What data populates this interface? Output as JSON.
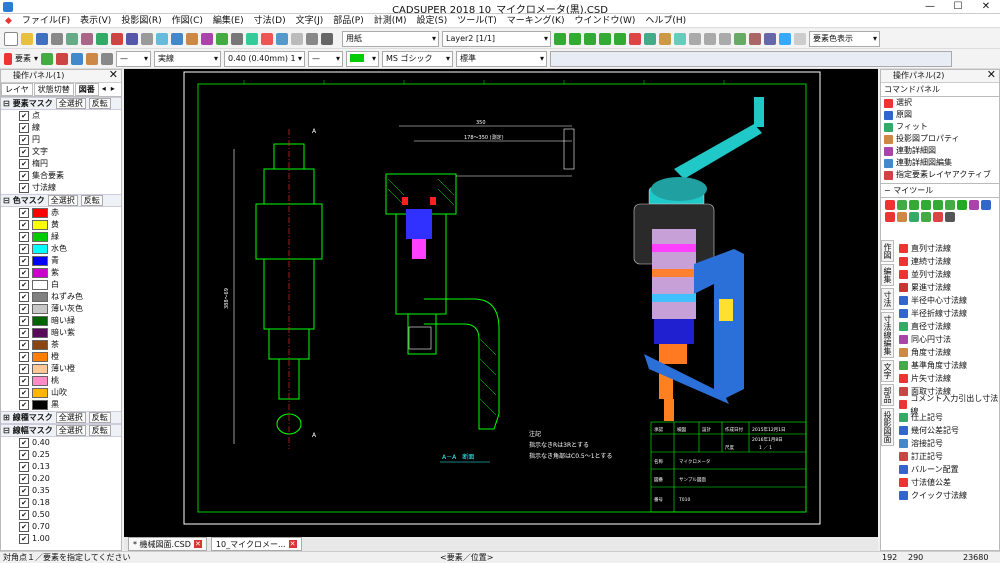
{
  "window": {
    "title": "CADSUPER 2018 10_マイクロメータ(黒).CSD"
  },
  "menu": [
    "ファイル(F)",
    "表示(V)",
    "投影図(R)",
    "作図(C)",
    "編集(E)",
    "寸法(D)",
    "文字(J)",
    "部品(P)",
    "計測(M)",
    "設定(S)",
    "ツール(T)",
    "マーキング(K)",
    "ウインドウ(W)",
    "ヘルプ(H)"
  ],
  "toolbar1": {
    "paper": "用紙",
    "layer": "Layer2 [1/1]",
    "color_display": "要素色表示"
  },
  "toolbar2": {
    "element": "要素",
    "linetype": "実線",
    "linewidth": "0.40 (0.40mm) 1",
    "font": "MS ゴシック",
    "style": "標準"
  },
  "left_panel": {
    "title": "操作パネル(1)",
    "tabs": [
      "レイヤ",
      "状態切替",
      "図番"
    ],
    "element_mask": {
      "label": "要素マスク",
      "select_all": "全選択",
      "invert": "反転",
      "items": [
        "点",
        "線",
        "円",
        "文字",
        "楕円",
        "集合要素",
        "寸法線"
      ]
    },
    "color_mask": {
      "label": "色マスク",
      "select_all": "全選択",
      "invert": "反転",
      "items": [
        {
          "name": "赤",
          "color": "#ff0000"
        },
        {
          "name": "黄",
          "color": "#ffff00"
        },
        {
          "name": "緑",
          "color": "#00cc00"
        },
        {
          "name": "水色",
          "color": "#00ffff"
        },
        {
          "name": "青",
          "color": "#0000ff"
        },
        {
          "name": "紫",
          "color": "#cc00cc"
        },
        {
          "name": "白",
          "color": "#ffffff"
        },
        {
          "name": "ねずみ色",
          "color": "#808080"
        },
        {
          "name": "薄い灰色",
          "color": "#c8c8c8"
        },
        {
          "name": "暗い緑",
          "color": "#006400"
        },
        {
          "name": "暗い紫",
          "color": "#5a0a5a"
        },
        {
          "name": "茶",
          "color": "#8b4513"
        },
        {
          "name": "橙",
          "color": "#ff8000"
        },
        {
          "name": "薄い橙",
          "color": "#ffc896"
        },
        {
          "name": "桃",
          "color": "#ff8cc8"
        },
        {
          "name": "山吹",
          "color": "#ffb400"
        },
        {
          "name": "黒",
          "color": "#000000"
        }
      ]
    },
    "linetype_mask": {
      "label": "線種マスク",
      "select_all": "全選択",
      "invert": "反転"
    },
    "linewidth_mask": {
      "label": "線幅マスク",
      "select_all": "全選択",
      "invert": "反転",
      "items": [
        "0.40",
        "0.25",
        "0.13",
        "0.20",
        "0.35",
        "0.18",
        "0.50",
        "0.70",
        "1.00"
      ]
    }
  },
  "drawing": {
    "dim_top": "350",
    "dim_top2": "178～350 (測定)",
    "dim_side": "388～69",
    "section_label_a": "A",
    "section_caption": "A－A　断面",
    "notes": [
      "注記",
      "指示なきRは3Rとする",
      "指示なき角部はC0.5～1とする"
    ],
    "title_block": {
      "headers": [
        "承認",
        "検図",
        "設計",
        "作成日付",
        "2015年12月1日"
      ],
      "revised": "2016年1月8日",
      "scale_label": "尺度",
      "scale": "1 ／ 1",
      "name_label": "名称",
      "name": "マイクロメータ",
      "company_label": "図番",
      "company": "サンプル図面",
      "number_label": "番号",
      "number": "T010"
    }
  },
  "doc_tabs": [
    "* 機械図面.CSD",
    "10_マイクロメー..."
  ],
  "status": {
    "left": "対角点１／要素を指定してください",
    "center": "<要素／位置>",
    "x": "192",
    "y": "290",
    "z": "23680"
  },
  "right_panel": {
    "title": "操作パネル(2)",
    "cmd_tab": "コマンドパネル",
    "commands": [
      "選択",
      "原図",
      "フィット",
      "投影図プロパティ",
      "連動詳細図",
      "連動詳細図編集",
      "指定要素レイヤアクティブ"
    ],
    "mytools_label": "マイツール",
    "vtabs": [
      "作図",
      "編集",
      "寸法",
      "寸法線編集",
      "文字",
      "部品",
      "投影図面"
    ],
    "dim_tools": [
      "直列寸法線",
      "連続寸法線",
      "並列寸法線",
      "累進寸法線",
      "半径中心寸法線",
      "半径折線寸法線",
      "直径寸法線",
      "同心円寸法",
      "角度寸法線",
      "基準角度寸法線",
      "片矢寸法線",
      "面取寸法線",
      "コメント入力引出し寸法線",
      "仕上記号",
      "幾何公差記号",
      "溶接記号",
      "訂正記号",
      "バルーン配置",
      "寸法値公差",
      "クイック寸法線"
    ]
  }
}
